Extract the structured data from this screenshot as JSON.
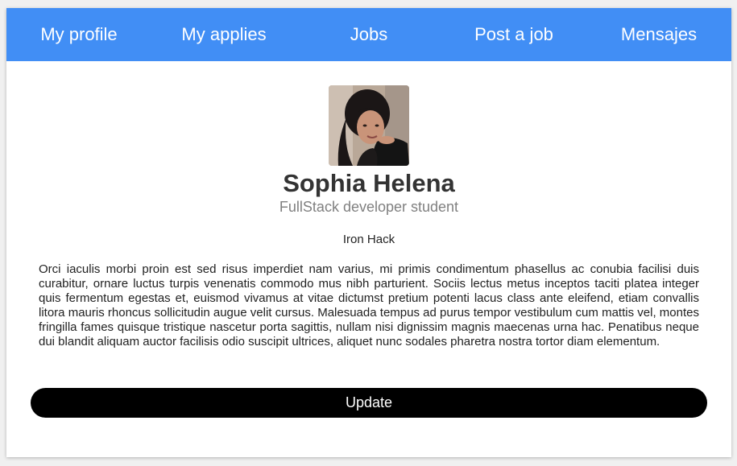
{
  "nav": {
    "items": [
      {
        "label": "My profile"
      },
      {
        "label": "My applies"
      },
      {
        "label": "Jobs"
      },
      {
        "label": "Post a job"
      },
      {
        "label": "Mensajes"
      }
    ]
  },
  "profile": {
    "name": "Sophia Helena",
    "role": "FullStack developer student",
    "school": "Iron Hack",
    "bio": "Orci iaculis morbi proin est sed risus imperdiet nam varius, mi primis condimentum phasellus ac conubia facilisi duis curabitur, ornare luctus turpis venenatis commodo mus nibh parturient. Sociis lectus metus inceptos taciti platea integer quis fermentum egestas et, euismod vivamus at vitae dictumst pretium potenti lacus class ante eleifend, etiam convallis litora mauris rhoncus sollicitudin augue velit cursus. Malesuada tempus ad purus tempor vestibulum cum mattis vel, montes fringilla fames quisque tristique nascetur porta sagittis, nullam nisi dignissim magnis maecenas urna hac. Penatibus neque dui blandit aliquam auctor facilisis odio suscipit ultrices, aliquet nunc sodales pharetra nostra tortor diam elementum.",
    "update_label": "Update"
  },
  "colors": {
    "nav_background": "#418ef5",
    "button_background": "#000000"
  }
}
